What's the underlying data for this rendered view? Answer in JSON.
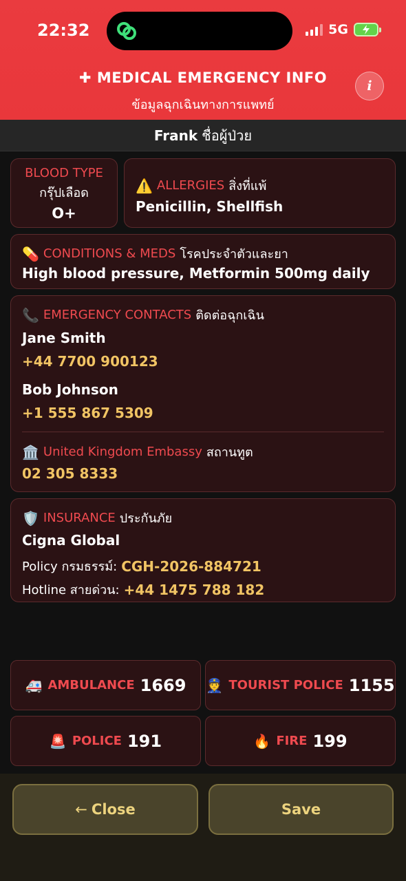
{
  "status": {
    "time": "22:32",
    "network": "5G"
  },
  "header": {
    "title": "MEDICAL EMERGENCY INFO",
    "subtitle": "ข้อมูลฉุกเฉินทางการแพทย์",
    "info_glyph": "i",
    "accent": "#ea3b3f"
  },
  "patient": {
    "name": "Frank",
    "label_th": "ชื่อผู้ป่วย"
  },
  "blood": {
    "label": "BLOOD TYPE",
    "label_th": "กรุ๊ปเลือด",
    "value": "O+"
  },
  "allergies": {
    "icon": "warning-icon",
    "label": "ALLERGIES",
    "label_th": "สิ่งที่แพ้",
    "value": "Penicillin, Shellfish"
  },
  "conditions": {
    "icon": "pill-icon",
    "label": "CONDITIONS & MEDS",
    "label_th": "โรคประจำตัวและยา",
    "value": "High blood pressure, Metformin 500mg daily"
  },
  "contacts": {
    "icon": "phone-icon",
    "label": "EMERGENCY CONTACTS",
    "label_th": "ติดต่อฉุกเฉิน",
    "people": [
      {
        "name": "Jane Smith",
        "phone": "+44 7700 900123"
      },
      {
        "name": "Bob Johnson",
        "phone": "+1 555 867 5309"
      }
    ],
    "embassy": {
      "icon": "embassy-icon",
      "name": "United Kingdom Embassy",
      "label_th": "สถานทูต",
      "phone": "02 305 8333"
    }
  },
  "insurance": {
    "icon": "shield-icon",
    "label": "INSURANCE",
    "label_th": "ประกันภัย",
    "provider": "Cigna Global",
    "policy_label": "Policy กรมธรรม์:",
    "policy": "CGH-2026-884721",
    "hotline_label": "Hotline สายด่วน:",
    "hotline": "+44 1475 788 182"
  },
  "emergency_numbers": [
    {
      "icon": "ambulance-icon",
      "name": "AMBULANCE",
      "number": "1669"
    },
    {
      "icon": "police-officer-icon",
      "name": "TOURIST POLICE",
      "number": "1155"
    },
    {
      "icon": "siren-icon",
      "name": "POLICE",
      "number": "191"
    },
    {
      "icon": "fire-icon",
      "name": "FIRE",
      "number": "199"
    }
  ],
  "footer": {
    "close_label": "Close",
    "close_arrow": "←",
    "save_label": "Save"
  }
}
